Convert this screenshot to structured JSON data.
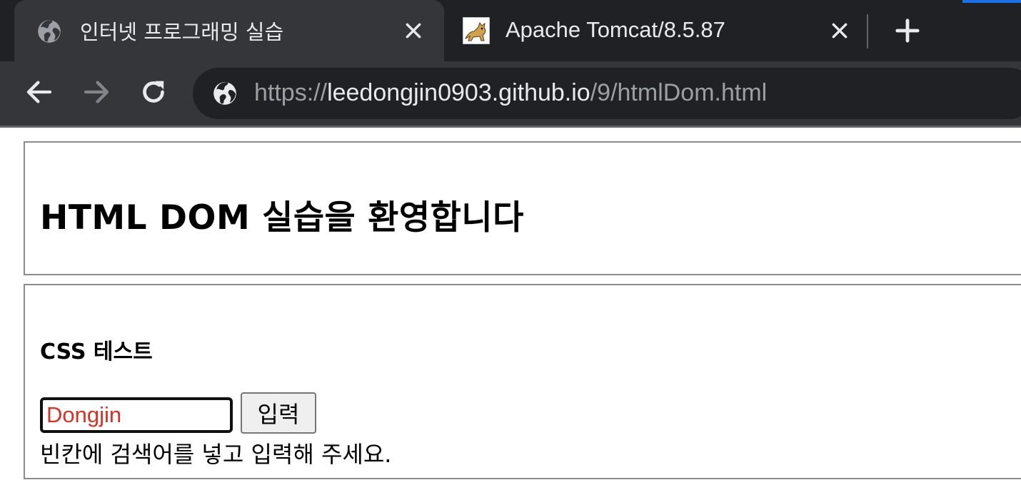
{
  "browser": {
    "accent_color": "#1a73e8",
    "tabs": [
      {
        "title": "인터넷 프로그래밍 실습",
        "icon": "globe-icon",
        "active": true
      },
      {
        "title": "Apache Tomcat/8.5.87",
        "icon": "tomcat-logo-icon",
        "active": false
      }
    ],
    "url": {
      "scheme": "https://",
      "host": "leedongjin0903.github.io",
      "path": "/9/htmlDom.html"
    }
  },
  "page": {
    "title": "HTML DOM 실습을 환영합니다",
    "section_title": "CSS 테스트",
    "search": {
      "value": "Dongjin",
      "text_color": "#d93025"
    },
    "submit_label": "입력",
    "helper_text": "빈칸에 검색어를 넣고 입력해 주세요."
  }
}
